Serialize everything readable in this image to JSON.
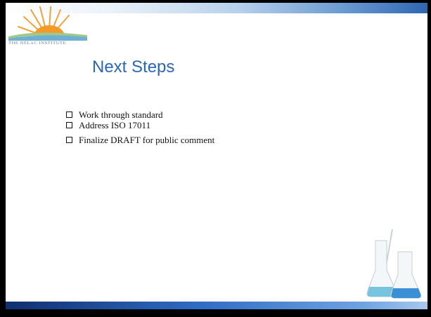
{
  "logo": {
    "text": "THE NELAC INSTITUTE",
    "icon": "sunrise-logo-icon"
  },
  "title": "Next Steps",
  "bullets": [
    {
      "label": "Work through standard"
    },
    {
      "label": "Address ISO 17011"
    },
    {
      "label": "Finalize DRAFT for public comment"
    }
  ],
  "decoration": {
    "icon": "lab-flasks-icon"
  },
  "colors": {
    "title": "#2a67b8",
    "top_bar": "#2f66b1",
    "bottom_bar": "#2f6ac4"
  }
}
